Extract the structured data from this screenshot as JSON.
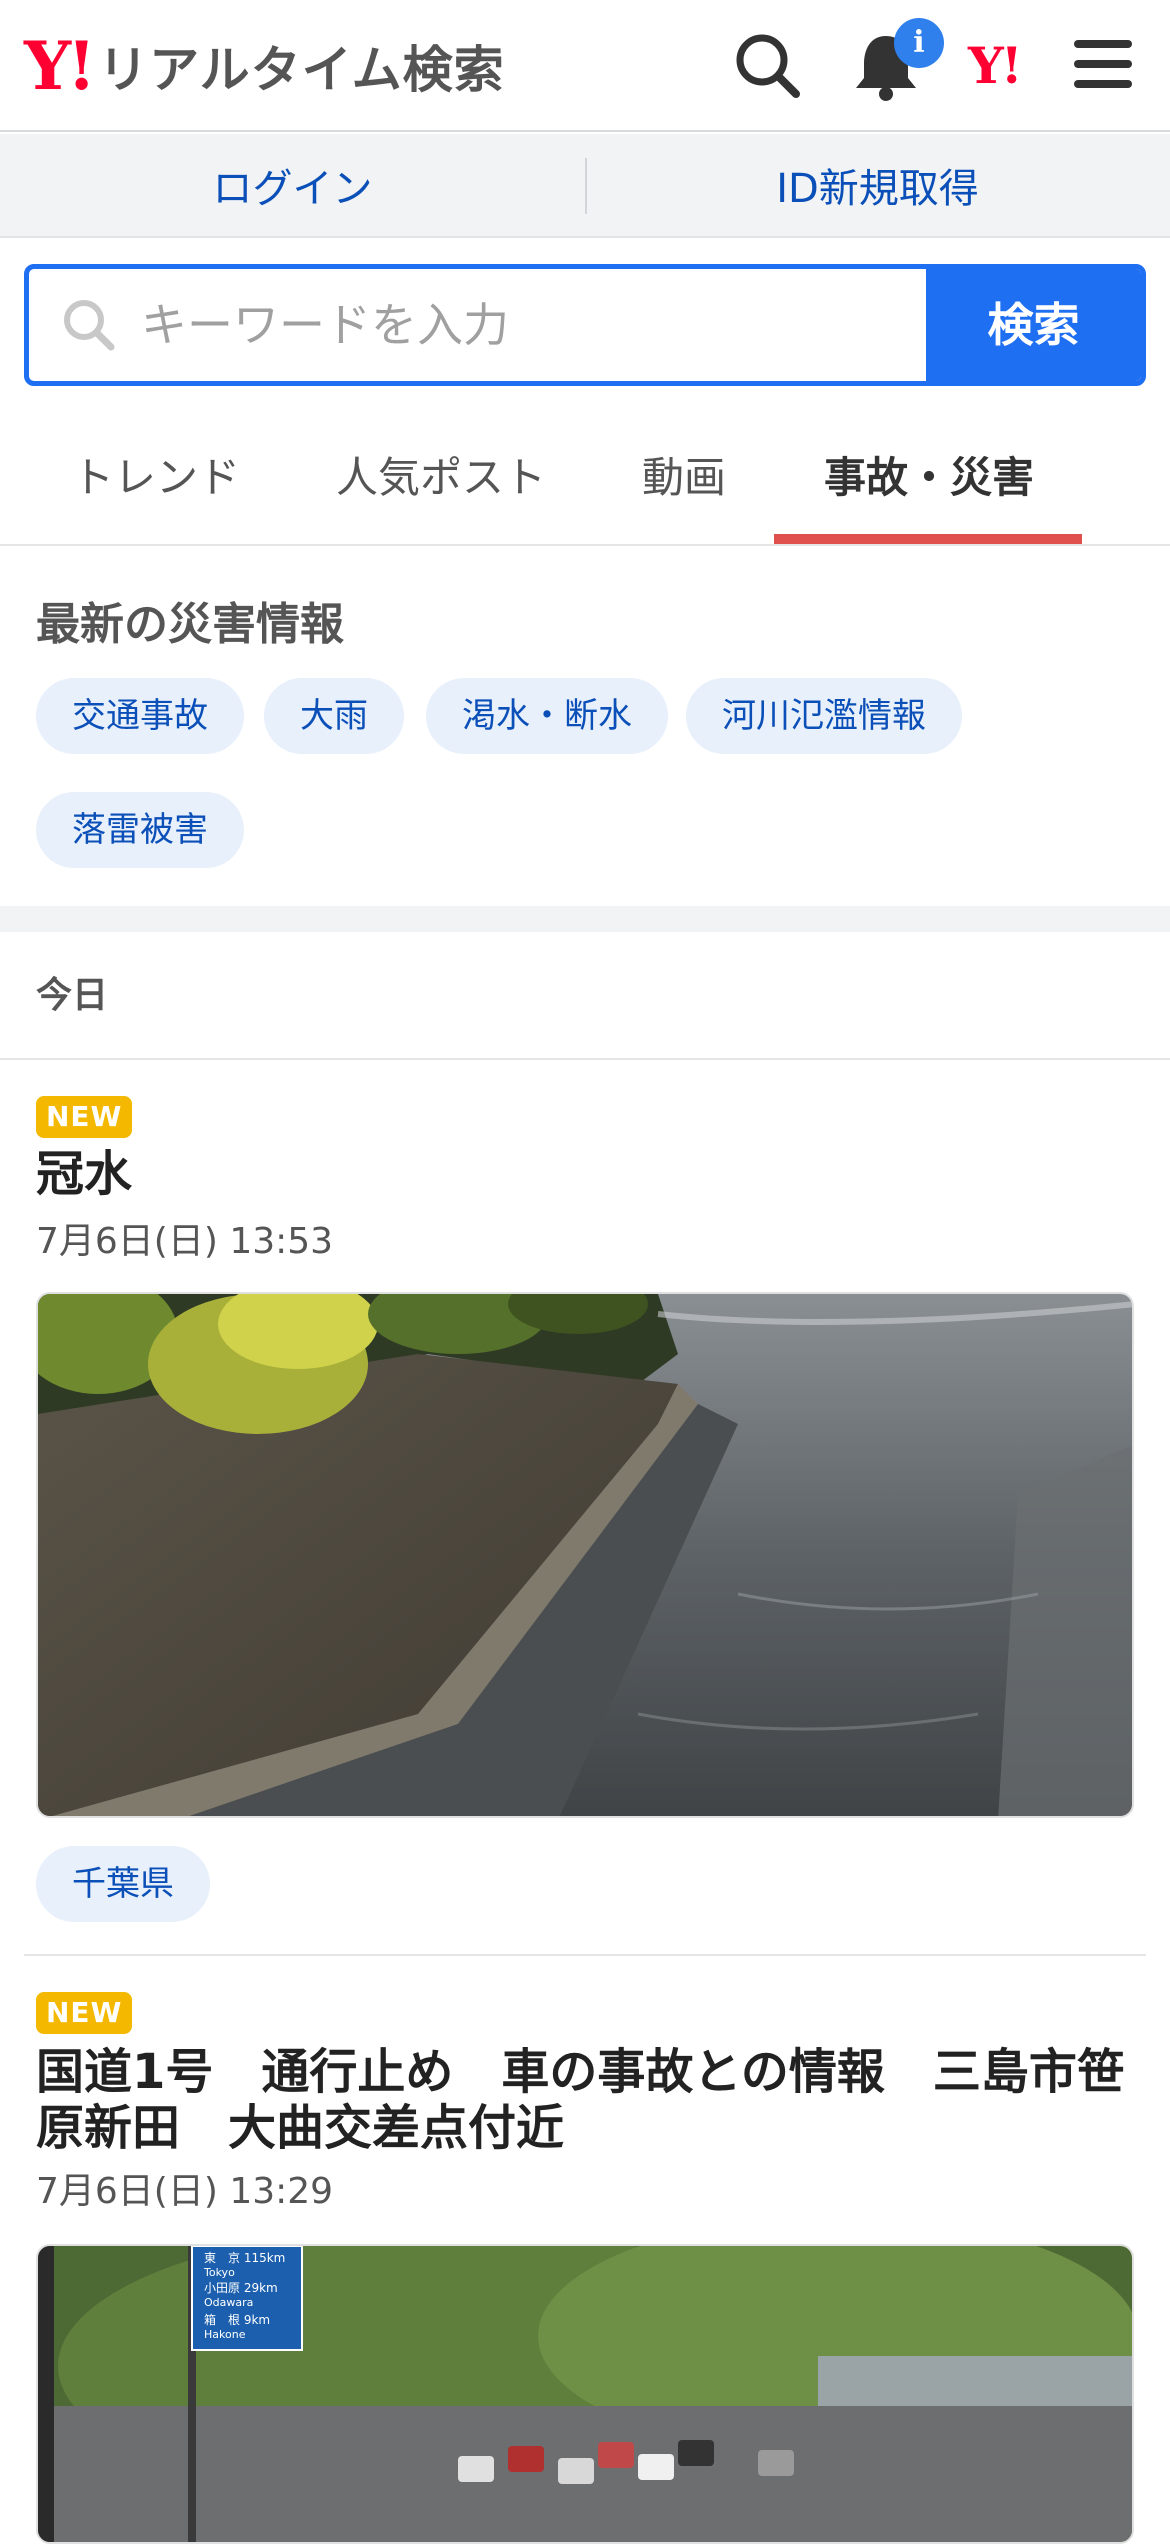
{
  "header": {
    "logo_mark": "Y!",
    "app_title": "リアルタイム検索",
    "notification_badge": "i",
    "yahoo_mark": "Y!"
  },
  "auth": {
    "login_label": "ログイン",
    "signup_label": "ID新規取得"
  },
  "search": {
    "placeholder": "キーワードを入力",
    "button_label": "検索"
  },
  "tabs": [
    {
      "label": "トレンド"
    },
    {
      "label": "人気ポスト"
    },
    {
      "label": "動画"
    },
    {
      "label": "事故・災害",
      "active": true
    }
  ],
  "disaster": {
    "title": "最新の災害情報",
    "chips": [
      "交通事故",
      "大雨",
      "渇水・断水",
      "河川氾濫情報",
      "落雷被害"
    ]
  },
  "timeline": {
    "section_label": "今日"
  },
  "posts": [
    {
      "badge": "NEW",
      "title": "冠水",
      "date": "7月6日(日) 13:53",
      "tag": "千葉県"
    },
    {
      "badge": "NEW",
      "title": "国道1号　通行止め　車の事故との情報　三島市笹原新田　大曲交差点付近",
      "date": "7月6日(日) 13:29",
      "sign_lines": [
        "東　京 115km",
        "Tokyo",
        "小田原 29km",
        "Odawara",
        "箱　根 9km",
        "Hakone"
      ]
    }
  ],
  "colors": {
    "brand_red": "#ff0033",
    "accent_blue": "#1f6ff2",
    "tab_underline": "#e0504c",
    "new_badge": "#f5b800",
    "chip_bg": "#e8f0fb"
  }
}
